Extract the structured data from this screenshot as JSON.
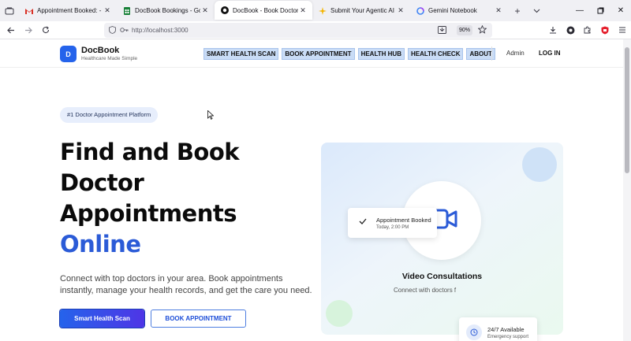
{
  "browser": {
    "tabs": [
      {
        "title": "Appointment Booked: - yyton",
        "icon": "gmail-icon",
        "active": false
      },
      {
        "title": "DocBook Bookings - Google S",
        "icon": "sheets-icon",
        "active": false
      },
      {
        "title": "DocBook - Book Doctor Appoi",
        "icon": "docbook-icon",
        "active": true
      },
      {
        "title": "Submit Your Agentic AI Proje",
        "icon": "spark-icon",
        "active": false
      },
      {
        "title": "Gemini Notebook",
        "icon": "gemini-icon",
        "active": false
      }
    ],
    "url": "http://localhost:3000",
    "zoom": "90%"
  },
  "site": {
    "logo_letter": "D",
    "brand": "DocBook",
    "tagline": "Healthcare Made Simple",
    "nav": [
      "SMART HEALTH SCAN",
      "BOOK APPOINTMENT",
      "HEALTH HUB",
      "HEALTH CHECK",
      "ABOUT"
    ],
    "admin": "Admin",
    "login": "LOG IN"
  },
  "hero": {
    "pill": "#1 Doctor Appointment Platform",
    "title_lines": [
      "Find and Book",
      "Doctor",
      "Appointments"
    ],
    "title_accent": "Online",
    "subtitle": "Connect with top doctors in your area. Book appointments instantly, manage your health records, and get the care you need.",
    "primary_button": "Smart Health Scan",
    "secondary_button": "BOOK APPOINTMENT"
  },
  "card": {
    "booked_title": "Appointment Booked",
    "booked_time": "Today, 2:00 PM",
    "video_title": "Video Consultations",
    "video_sub": "Connect with doctors f",
    "avail_title": "24/7 Available",
    "avail_sub": "Emergency support"
  },
  "colors": {
    "accent": "#2b5bd7",
    "primary": "#2563eb",
    "nav_highlight": "#c9dcf6"
  }
}
